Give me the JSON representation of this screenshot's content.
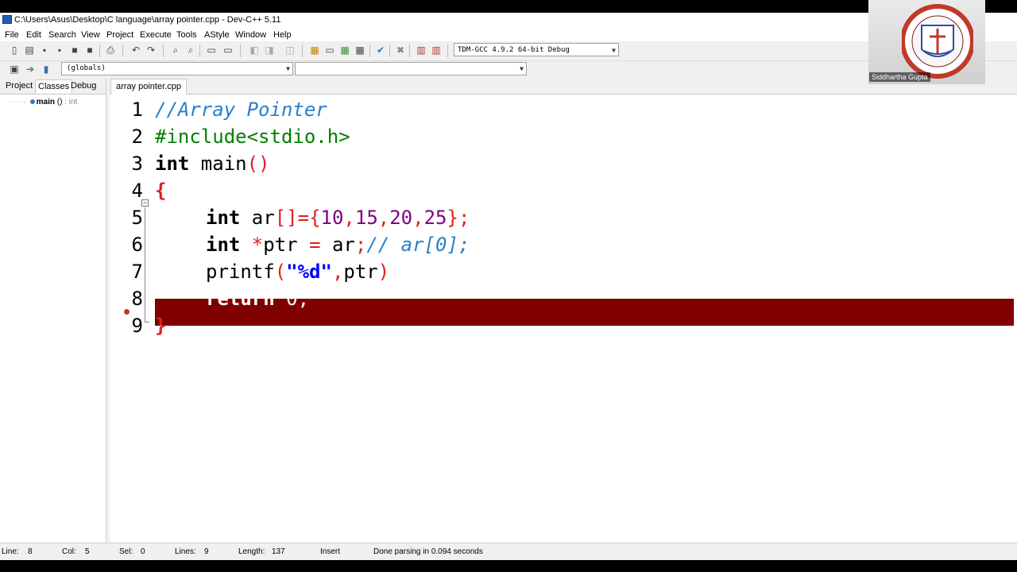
{
  "window": {
    "title": "C:\\Users\\Asus\\Desktop\\C language\\array pointer.cpp - Dev-C++ 5.11"
  },
  "menu": [
    "File",
    "Edit",
    "Search",
    "View",
    "Project",
    "Execute",
    "Tools",
    "AStyle",
    "Window",
    "Help"
  ],
  "toolbar": {
    "compiler_select": "TDM-GCC 4.9.2 64-bit Debug",
    "scope_select": "(globals)",
    "member_select": ""
  },
  "left_panel": {
    "tabs": [
      "Project",
      "Classes",
      "Debug"
    ],
    "active_tab": "Classes",
    "tree": {
      "function": "main",
      "signature": "()",
      "return_type": ": int"
    }
  },
  "editor": {
    "file_tab": "array pointer.cpp",
    "line_numbers": [
      "1",
      "2",
      "3",
      "4",
      "5",
      "6",
      "7",
      "8",
      "9"
    ],
    "highlighted_line": 8,
    "highlight_color": "#800000",
    "code": {
      "l1": "//Array Pointer",
      "l2": "#include<stdio.h>",
      "l3_kw": "int",
      "l3_rest": " main",
      "l3_sym": "()",
      "l4": "{",
      "l5_kw": "int",
      "l5_a": " ar",
      "l5_b": "[]={",
      "l5_n1": "10",
      "l5_c1": ",",
      "l5_n2": "15",
      "l5_c2": ",",
      "l5_n3": "20",
      "l5_c3": ",",
      "l5_n4": "25",
      "l5_end": "};",
      "l6_kw": "int",
      "l6_a": " *",
      "l6_b": "ptr ",
      "l6_c": "=",
      "l6_d": " ar",
      "l6_e": ";",
      "l6_cm": "// ar[0];",
      "l7_a": "printf",
      "l7_b": "(",
      "l7_str": "\"%d\"",
      "l7_c": ",",
      "l7_d": "ptr",
      "l7_e": ")",
      "l8_kw": "return",
      "l8_rest": " 0;",
      "l9": "}"
    }
  },
  "status": {
    "line_label": "Line:",
    "line": "8",
    "col_label": "Col:",
    "col": "5",
    "sel_label": "Sel:",
    "sel": "0",
    "lines_label": "Lines:",
    "lines": "9",
    "length_label": "Length:",
    "length": "137",
    "mode": "Insert",
    "message": "Done parsing in 0.094 seconds"
  },
  "webcam": {
    "name": "Siddhartha Gupta"
  }
}
